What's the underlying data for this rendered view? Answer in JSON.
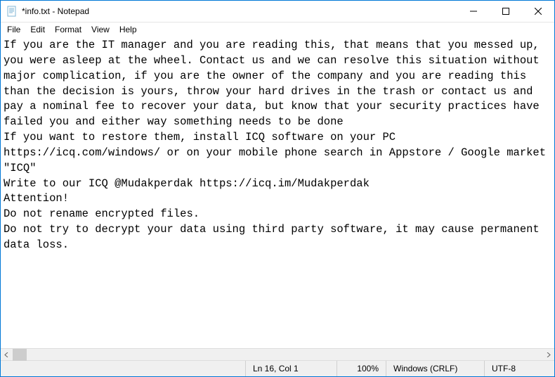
{
  "window": {
    "title": "*info.txt - Notepad"
  },
  "menu": {
    "file": "File",
    "edit": "Edit",
    "format": "Format",
    "view": "View",
    "help": "Help"
  },
  "content": "If you are the IT manager and you are reading this, that means that you messed up, you were asleep at the wheel. Contact us and we can resolve this situation without major complication, if you are the owner of the company and you are reading this than the decision is yours, throw your hard drives in the trash or contact us and pay a nominal fee to recover your data, but know that your security practices have failed you and either way something needs to be done\nIf you want to restore them, install ICQ software on your PC https://icq.com/windows/ or on your mobile phone search in Appstore / Google market \"ICQ\"\nWrite to our ICQ @Mudakperdak https://icq.im/Mudakperdak\nAttention!\nDo not rename encrypted files.\nDo not try to decrypt your data using third party software, it may cause permanent data loss.",
  "status": {
    "position": "Ln 16, Col 1",
    "zoom": "100%",
    "eol": "Windows (CRLF)",
    "encoding": "UTF-8"
  }
}
